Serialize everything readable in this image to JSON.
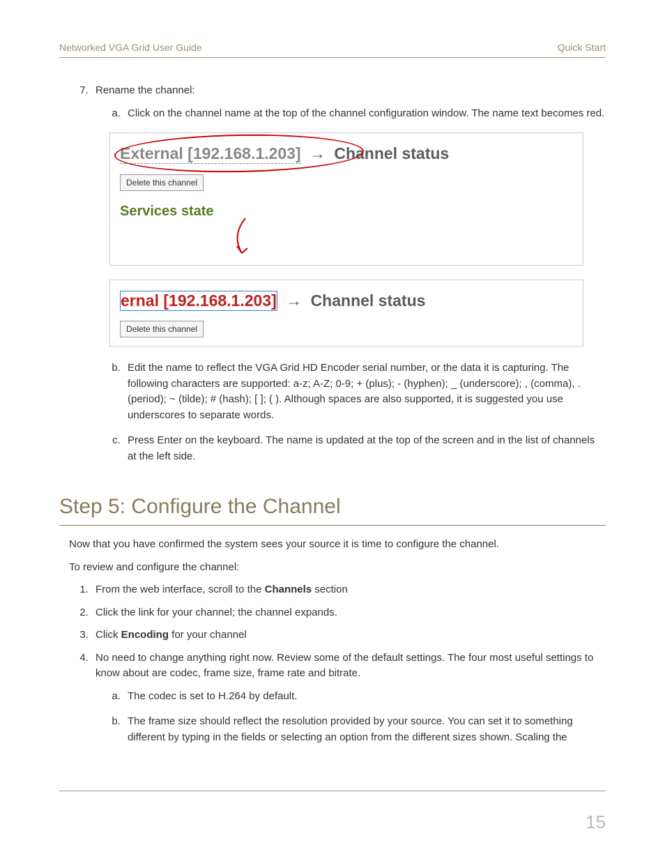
{
  "header": {
    "left": "Networked VGA Grid User Guide",
    "right": "Quick Start"
  },
  "step7": {
    "number": "7.",
    "title": "Rename the channel:",
    "a": "Click on the channel name at the top of the channel configuration window. The name text becomes red.",
    "b": "Edit the name to reflect the VGA Grid HD Encoder serial number, or the data it is capturing. The following characters are supported: a-z; A-Z; 0-9; + (plus); - (hyphen); _ (underscore); , (comma), . (period); ~ (tilde); # (hash); [ ]; ( ). Although spaces are also supported, it is suggested you use underscores to separate words.",
    "c": "Press Enter on the keyboard. The name is updated at the top of the screen and in the list of channels at the left side."
  },
  "figure1": {
    "channel_name": "External [192.168.1.203]",
    "arrow": "→",
    "status_label": "Channel status",
    "delete_label": "Delete this channel",
    "services_label": "Services state"
  },
  "figure2": {
    "channel_name": "ernal [192.168.1.203]",
    "arrow": "→",
    "status_label": "Channel status",
    "delete_label": "Delete this channel"
  },
  "step5": {
    "heading": "Step 5: Configure the Channel",
    "intro1": "Now that you have confirmed the system sees your source it is time to configure the channel.",
    "intro2": "To review and configure the channel:",
    "items": {
      "1_pre": "From the web interface, scroll to the ",
      "1_bold": "Channels",
      "1_post": " section",
      "2": "Click the link for your channel; the channel expands.",
      "3_pre": "Click ",
      "3_bold": "Encoding",
      "3_post": " for your channel",
      "4": "No need to change anything right now. Review some of the default settings. The four most useful settings to know about are codec, frame size, frame rate and bitrate.",
      "4a": "The codec is set to H.264 by default.",
      "4b": "The frame size should reflect the resolution provided by your source. You can set it to something different by typing in the fields or selecting an option from the different sizes shown. Scaling the"
    }
  },
  "page_number": "15"
}
